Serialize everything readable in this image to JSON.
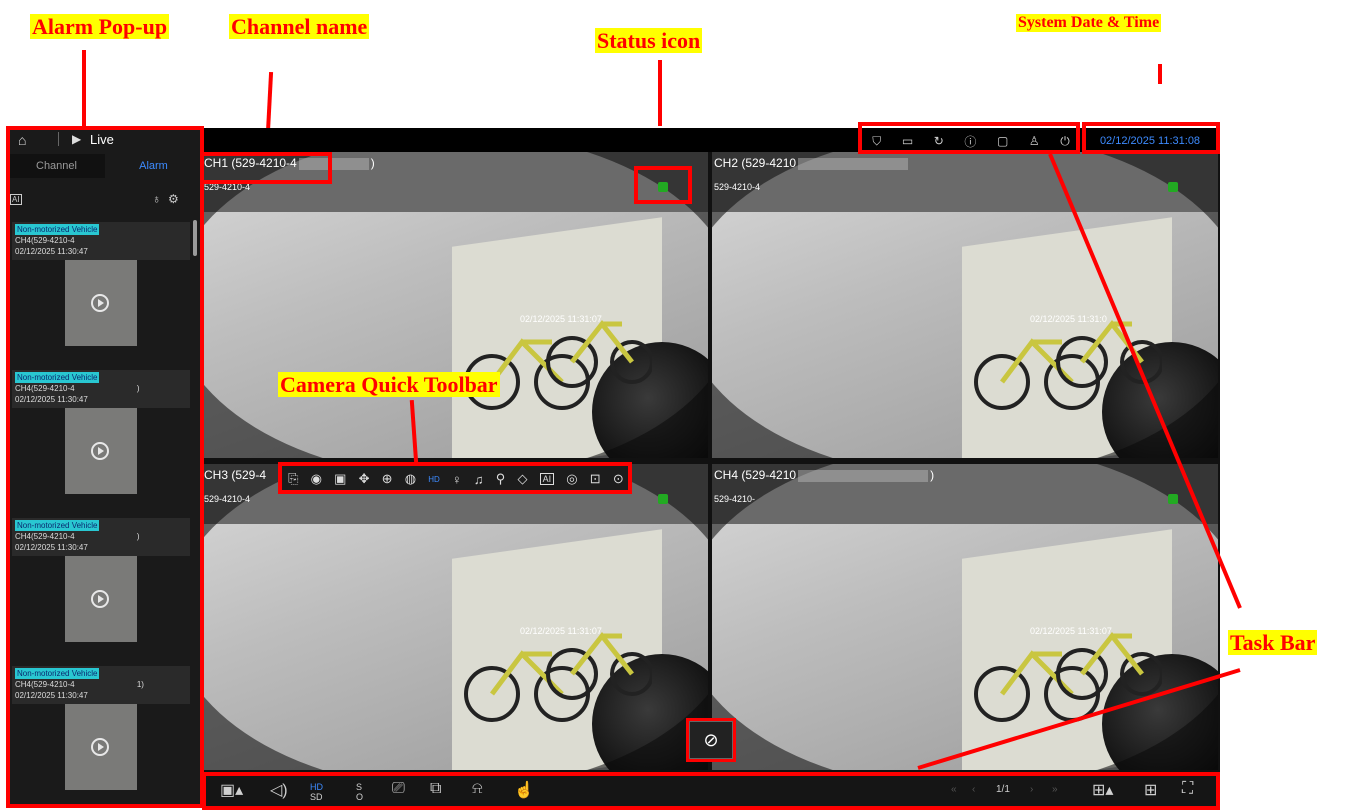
{
  "annotations": {
    "alarm_popup": "Alarm Pop-up",
    "channel_name": "Channel name",
    "status_icon": "Status icon",
    "system_date_time": "System Date & Time",
    "camera_quick_toolbar": "Camera Quick Toolbar",
    "task_bar": "Task Bar"
  },
  "sidebar": {
    "home_icon": "home-icon",
    "title": "Live",
    "tabs": [
      "Channel",
      "Alarm"
    ],
    "filter_label": "AI",
    "alarms": [
      {
        "type": "Non-motorized Vehicle",
        "channel": "CH4(529-4210-4",
        "time": "02/12/2025 11:30:47"
      },
      {
        "type": "Non-motorized Vehicle",
        "channel": "CH4(529-4210-4",
        "time": "02/12/2025 11:30:47",
        "tail": ")"
      },
      {
        "type": "Non-motorized Vehicle",
        "channel": "CH4(529-4210-4",
        "time": "02/12/2025 11:30:47",
        "tail": ")"
      },
      {
        "type": "Non-motorized Vehicle",
        "channel": "CH4(529-4210-4",
        "time": "02/12/2025 11:30:47",
        "tail": "1)"
      }
    ]
  },
  "channels": [
    {
      "name": "CH1 (529-4210-4",
      "tail": ")",
      "sub": "529-4210-4",
      "osd_time": "02/12/2025 11:31:07"
    },
    {
      "name": "CH2 (529-4210",
      "tail": "",
      "sub": "529-4210-4",
      "osd_time": "02/12/2025 11:31:0"
    },
    {
      "name": "CH3 (529-4",
      "tail": "",
      "sub": "529-4210-4",
      "osd_time": "02/12/2025 11:31:07"
    },
    {
      "name": "CH4 (529-4210",
      "tail": ")",
      "sub": "529-4210-",
      "osd_time": "02/12/2025 11:31:07"
    }
  ],
  "quick_toolbar": {
    "icons": [
      "record-icon",
      "snapshot-icon",
      "playback-icon",
      "ptz-icon",
      "zoom-icon",
      "color-icon",
      "hd-sd-icon",
      "light-icon",
      "alarm-icon",
      "talk-icon",
      "tag-icon",
      "ai-icon",
      "fisheye-icon",
      "crop-icon",
      "target-icon"
    ],
    "hd_label": "HD",
    "ai_label": "AI"
  },
  "status_bar": {
    "icons": [
      "shield-icon",
      "message-icon",
      "sync-icon",
      "info-icon",
      "display-icon",
      "user-icon",
      "power-icon"
    ],
    "datetime": "02/12/2025 11:31:08"
  },
  "taskbar": {
    "page_indicator": "1/1",
    "hd_label": "HD",
    "sd_label": "SD",
    "s_label": "S",
    "o_label": "O"
  }
}
